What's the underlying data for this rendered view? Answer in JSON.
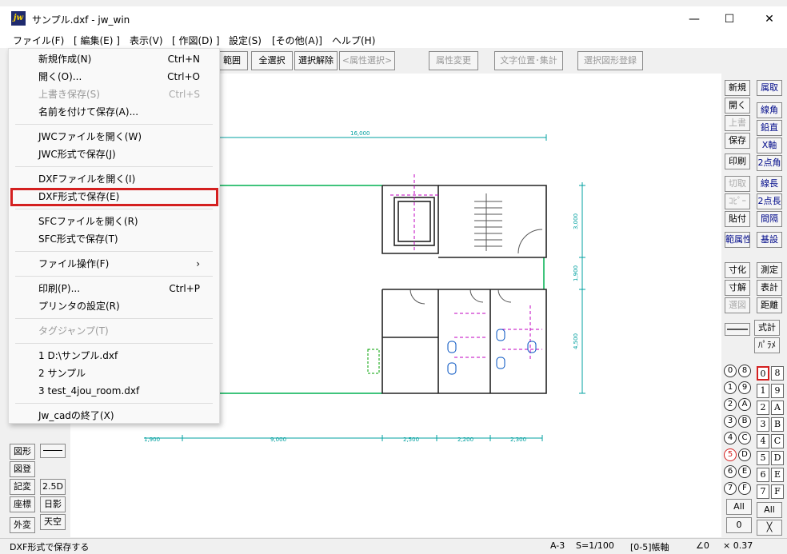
{
  "window": {
    "title": "サンプル.dxf - jw_win",
    "icon": "jw",
    "minimize": "—",
    "maximize": "☐",
    "close": "✕"
  },
  "menubar": [
    "ファイル(F)",
    "[ 編集(E) ]",
    "表示(V)",
    "[ 作図(D) ]",
    "設定(S)",
    "[その他(A)]",
    "ヘルプ(H)"
  ],
  "toolbar": {
    "range": "範囲",
    "select_all": "全選択",
    "deselect": "選択解除",
    "attr_select": "<属性選択>",
    "attr_change": "属性変更",
    "text_pos": "文字位置･集計",
    "sel_register": "選択図形登録"
  },
  "file_menu": {
    "new": "新規作成(N)",
    "new_sc": "Ctrl+N",
    "open": "開く(O)...",
    "open_sc": "Ctrl+O",
    "overwrite": "上書き保存(S)",
    "overwrite_sc": "Ctrl+S",
    "save_as": "名前を付けて保存(A)...",
    "jwc_open": "JWCファイルを開く(W)",
    "jwc_save": "JWC形式で保存(J)",
    "dxf_open": "DXFファイルを開く(I)",
    "dxf_save": "DXF形式で保存(E)",
    "sfc_open": "SFCファイルを開く(R)",
    "sfc_save": "SFC形式で保存(T)",
    "file_ops": "ファイル操作(F)",
    "file_ops_arrow": "›",
    "print": "印刷(P)...",
    "print_sc": "Ctrl+P",
    "printer": "プリンタの設定(R)",
    "tag_jump": "タグジャンプ(T)",
    "recent1": "1 D:\\サンプル.dxf",
    "recent2": "2 サンプル",
    "recent3": "3 test_4jou_room.dxf",
    "exit": "Jw_cadの終了(X)"
  },
  "left_panel": {
    "zukei": "図形",
    "zutou": "図登",
    "kihen": "記変",
    "d25": "2.5D",
    "zahyo": "座標",
    "nichiei": "日影",
    "gaihen": "外変",
    "tenku": "天空"
  },
  "right_panel_left": [
    "新規",
    "開く",
    "上書",
    "保存",
    "印刷",
    "切取",
    "ｺﾋﾟｰ",
    "貼付",
    "範属性",
    "寸化",
    "寸解",
    "選図",
    "",
    "式計",
    "ﾊﾟﾗﾒ"
  ],
  "right_panel_right": [
    "属取",
    "線角",
    "鉛直",
    "X軸",
    "2点角",
    "線長",
    "2点長",
    "間隔",
    "基設",
    "測定",
    "表計",
    "距離"
  ],
  "layers_circle": [
    "0",
    "8",
    "1",
    "9",
    "2",
    "A",
    "3",
    "B",
    "4",
    "C",
    "5",
    "D",
    "6",
    "E",
    "7",
    "F"
  ],
  "layers_square": [
    "0",
    "8",
    "1",
    "9",
    "2",
    "A",
    "3",
    "B",
    "4",
    "C",
    "5",
    "D",
    "6",
    "E",
    "7",
    "F"
  ],
  "layer_all": "All",
  "layer_zero": "0",
  "group_all": "All",
  "group_x": "╳",
  "dims": {
    "top": "16,000",
    "right1": "3,000",
    "right2": "1,900",
    "right3": "4,500",
    "b1": "1,900",
    "b2": "9,000",
    "b3": "2,500",
    "b4": "2,200",
    "b5": "2,300"
  },
  "statusbar": {
    "message": "DXF形式で保存する",
    "paper": "A-3",
    "scale": "S=1/100",
    "layer": "[0-5]帳軸",
    "angle": "∠0",
    "ratio": "× 0.37"
  }
}
